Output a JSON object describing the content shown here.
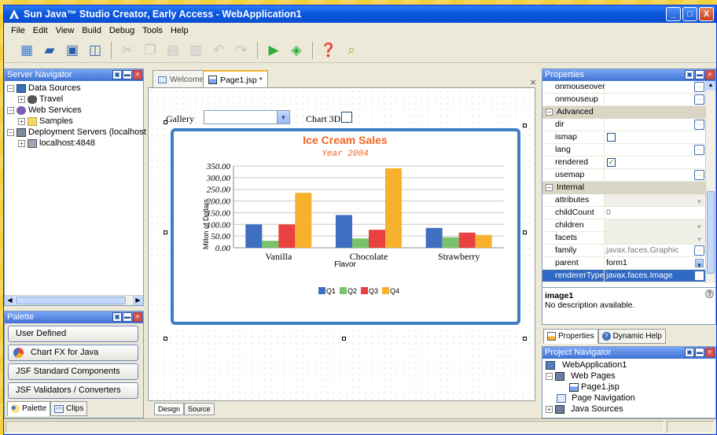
{
  "window": {
    "title": "Sun Java™ Studio Creator, Early Access - WebApplication1",
    "buttons": {
      "min": "_",
      "max": "□",
      "close": "X"
    }
  },
  "menu": [
    "File",
    "Edit",
    "View",
    "Build",
    "Debug",
    "Tools",
    "Help"
  ],
  "server_navigator": {
    "title": "Server Navigator",
    "items": [
      {
        "label": "Data Sources",
        "exp": "−"
      },
      {
        "label": "Travel",
        "exp": "+"
      },
      {
        "label": "Web Services",
        "exp": "−"
      },
      {
        "label": "Samples",
        "exp": "+"
      },
      {
        "label": "Deployment Servers (localhost",
        "exp": "−"
      },
      {
        "label": "localhost:4848",
        "exp": "+"
      }
    ]
  },
  "palette": {
    "title": "Palette",
    "buttons": [
      "User Defined",
      "Chart FX for Java",
      "JSF Standard Components",
      "JSF Validators / Converters"
    ],
    "tabs": [
      "Palette",
      "Clips"
    ]
  },
  "editor": {
    "tabs": [
      "Welcome",
      "Page1.jsp *"
    ],
    "close": "×",
    "gallery_label": "Gallery",
    "chart3d_label": "Chart 3D",
    "bottom_tabs": [
      "Design",
      "Source"
    ]
  },
  "chart_data": {
    "type": "bar",
    "title": "Ice Cream Sales",
    "subtitle": "Year 2004",
    "xlabel": "Flavor",
    "ylabel": "Millon of Dollars",
    "categories": [
      "Vanilla",
      "Chocolate",
      "Strawberry"
    ],
    "series": [
      {
        "name": "Q1",
        "values": [
          100,
          140,
          85
        ]
      },
      {
        "name": "Q2",
        "values": [
          30,
          40,
          45
        ]
      },
      {
        "name": "Q3",
        "values": [
          100,
          77,
          65
        ]
      },
      {
        "name": "Q4",
        "values": [
          235,
          340,
          55
        ]
      }
    ],
    "colors": [
      "#3e6fc1",
      "#79c46a",
      "#e8413f",
      "#f7b12c"
    ],
    "yticks": [
      "350.00",
      "300.00",
      "250.00",
      "200.00",
      "150.00",
      "100.00",
      "50.00",
      "0.00"
    ],
    "ylim": [
      0,
      350
    ],
    "grid": true,
    "legend": "bottom"
  },
  "properties": {
    "title": "Properties",
    "rows": [
      {
        "kind": "prop",
        "name": "onmouseover",
        "value": "",
        "widget": "dots"
      },
      {
        "kind": "prop",
        "name": "onmouseup",
        "value": "",
        "widget": "dots"
      },
      {
        "kind": "section",
        "name": "Advanced"
      },
      {
        "kind": "prop",
        "name": "dir",
        "value": "",
        "widget": "dots"
      },
      {
        "kind": "prop",
        "name": "ismap",
        "value": "",
        "widget": "checkbox",
        "checked": false
      },
      {
        "kind": "prop",
        "name": "lang",
        "value": "",
        "widget": "dots"
      },
      {
        "kind": "prop",
        "name": "rendered",
        "value": "",
        "widget": "checkbox",
        "checked": true
      },
      {
        "kind": "prop",
        "name": "usemap",
        "value": "",
        "widget": "dots"
      },
      {
        "kind": "section",
        "name": "Internal"
      },
      {
        "kind": "prop",
        "name": "attributes",
        "value": "",
        "widget": "dropdown",
        "grey": true
      },
      {
        "kind": "prop",
        "name": "childCount",
        "value": "0",
        "widget": "none"
      },
      {
        "kind": "prop",
        "name": "children",
        "value": "",
        "widget": "dropdown",
        "grey": true
      },
      {
        "kind": "prop",
        "name": "facets",
        "value": "",
        "widget": "dropdown",
        "grey": true
      },
      {
        "kind": "prop",
        "name": "family",
        "value": "javax.faces.Graphic",
        "widget": "dots"
      },
      {
        "kind": "prop",
        "name": "parent",
        "value": "form1",
        "widget": "dropdown-blue",
        "dark": true
      },
      {
        "kind": "prop",
        "name": "rendererType",
        "value": "javax.faces.Image",
        "widget": "dots",
        "selected": true
      }
    ],
    "component_name": "image1",
    "description": "No description available.",
    "tabs": [
      "Properties",
      "Dynamic Help"
    ]
  },
  "project_navigator": {
    "title": "Project Navigator",
    "items": [
      {
        "label": "WebApplication1",
        "exp": ""
      },
      {
        "label": "Web Pages",
        "exp": "−"
      },
      {
        "label": "Page1.jsp",
        "exp": ""
      },
      {
        "label": "Page Navigation",
        "exp": ""
      },
      {
        "label": "Java Sources",
        "exp": "+"
      }
    ]
  }
}
